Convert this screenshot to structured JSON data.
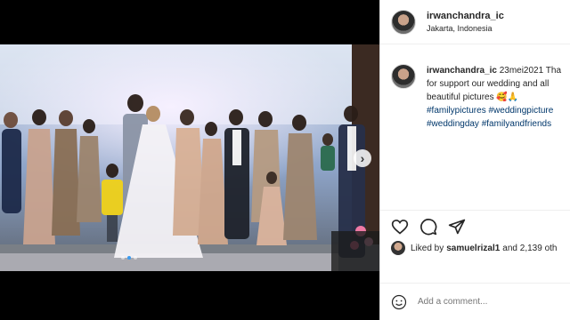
{
  "post": {
    "username": "irwanchandra_ic",
    "location": "Jakarta, Indonesia",
    "caption_username": "irwanchandra_ic",
    "caption_line1": " 23mei2021 Tha",
    "caption_line2": "for support our wedding and all",
    "caption_line3": "beautiful pictures 🥰🙏",
    "hashtags_line1": "#familypictures #weddingpicture",
    "hashtags_line2": "#weddingday #familyandfriends"
  },
  "likes": {
    "prefix": "Liked by ",
    "user": "samuelrizal1",
    "suffix": " and 2,139 oth"
  },
  "comment": {
    "placeholder": "Add a comment..."
  },
  "icons": {
    "like": "heart-icon",
    "comment": "comment-icon",
    "share": "paper-plane-icon",
    "next": "chevron-right-icon",
    "emoji": "smiley-icon"
  },
  "carousel": {
    "slides": 3,
    "active_slide": 2
  },
  "colors": {
    "hashtag": "#00376b",
    "dot_active": "#3a9bf0"
  }
}
